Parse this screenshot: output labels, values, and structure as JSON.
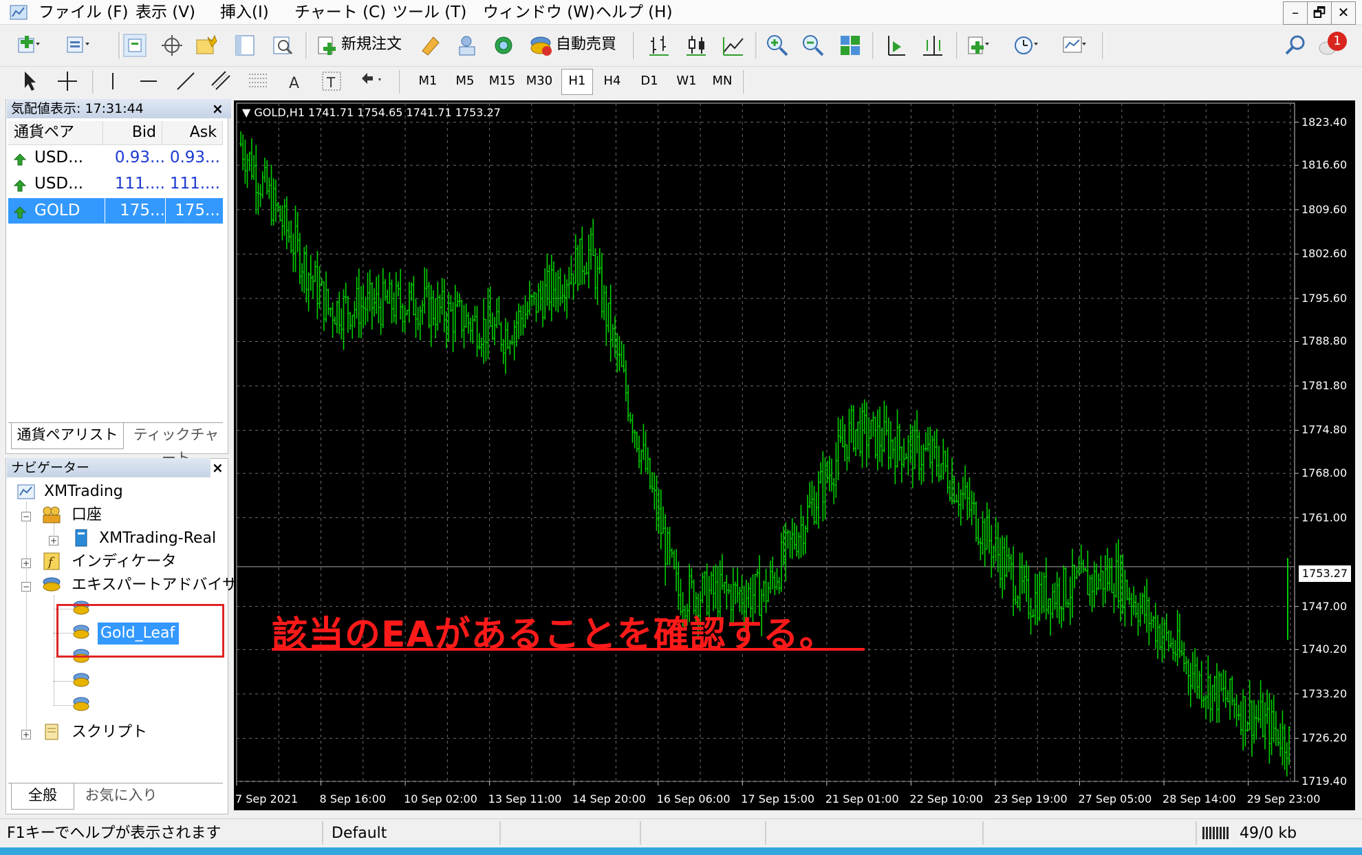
{
  "menu": {
    "items": [
      "ファイル (F)",
      "表示 (V)",
      "挿入(I)",
      "チャート (C)",
      "ツール (T)",
      "ウィンドウ (W)",
      "ヘルプ (H)"
    ]
  },
  "window_controls": {
    "minimize": "–",
    "restore": "🗗",
    "close": "✕"
  },
  "toolbar": {
    "new_order_label": "新規注文",
    "auto_trading_label": "自動売買",
    "notification_count": "1"
  },
  "timeframes": [
    "M1",
    "M5",
    "M15",
    "M30",
    "H1",
    "H4",
    "D1",
    "W1",
    "MN"
  ],
  "active_timeframe": "H1",
  "market_watch": {
    "title": "気配値表示: 17:31:44",
    "close_icon": "×",
    "headers": {
      "symbol": "通貨ペア",
      "bid": "Bid",
      "ask": "Ask"
    },
    "rows": [
      {
        "symbol": "USD...",
        "bid": "0.93...",
        "ask": "0.93..."
      },
      {
        "symbol": "USD...",
        "bid": "111....",
        "ask": "111...."
      },
      {
        "symbol": "GOLD",
        "bid": "175...",
        "ask": "175..."
      }
    ],
    "tabs": [
      "通貨ペアリスト",
      "ティックチャート"
    ]
  },
  "navigator": {
    "title": "ナビゲーター",
    "close_icon": "×",
    "root": "XMTrading",
    "accounts": "口座",
    "account_server": "XMTrading-Real",
    "indicators": "インディケータ",
    "experts": "エキスパートアドバイザ",
    "selected_ea": "Gold_Leaf",
    "scripts": "スクリプト",
    "tabs": [
      "全般",
      "お気に入り"
    ]
  },
  "chart": {
    "header": "GOLD,H1  1741.71 1754.65 1741.71 1753.27",
    "current_price": "1753.27",
    "annotation": "該当のEAがあることを確認する。",
    "price_levels": [
      "1823.40",
      "1816.60",
      "1809.60",
      "1802.60",
      "1795.60",
      "1788.80",
      "1781.80",
      "1774.80",
      "1768.00",
      "1761.00",
      "1747.00",
      "1740.20",
      "1733.20",
      "1726.20",
      "1719.40"
    ],
    "time_labels": [
      "7 Sep 2021",
      "8 Sep 16:00",
      "10 Sep 02:00",
      "13 Sep 11:00",
      "14 Sep 20:00",
      "16 Sep 06:00",
      "17 Sep 15:00",
      "21 Sep 01:00",
      "22 Sep 10:00",
      "23 Sep 19:00",
      "27 Sep 05:00",
      "28 Sep 14:00",
      "29 Sep 23:00"
    ],
    "bar_color": "#00d000",
    "background": "#000000"
  },
  "chart_data": {
    "type": "line",
    "title": "GOLD,H1",
    "x": [
      "7 Sep 2021",
      "8 Sep 16:00",
      "10 Sep 02:00",
      "13 Sep 11:00",
      "14 Sep 20:00",
      "16 Sep 06:00",
      "17 Sep 15:00",
      "21 Sep 01:00",
      "22 Sep 10:00",
      "23 Sep 19:00",
      "27 Sep 05:00",
      "28 Sep 14:00",
      "29 Sep 23:00"
    ],
    "series": [
      {
        "name": "GOLD",
        "values": [
          1820,
          1794,
          1795,
          1790,
          1803,
          1749,
          1749,
          1775,
          1770,
          1748,
          1752,
          1735,
          1726
        ]
      }
    ],
    "ylim": [
      1719.4,
      1826.4
    ],
    "last": 1753.27,
    "grid": true
  },
  "statusbar": {
    "help": "F1キーでヘルプが表示されます",
    "profile": "Default",
    "traffic": "49/0 kb"
  }
}
